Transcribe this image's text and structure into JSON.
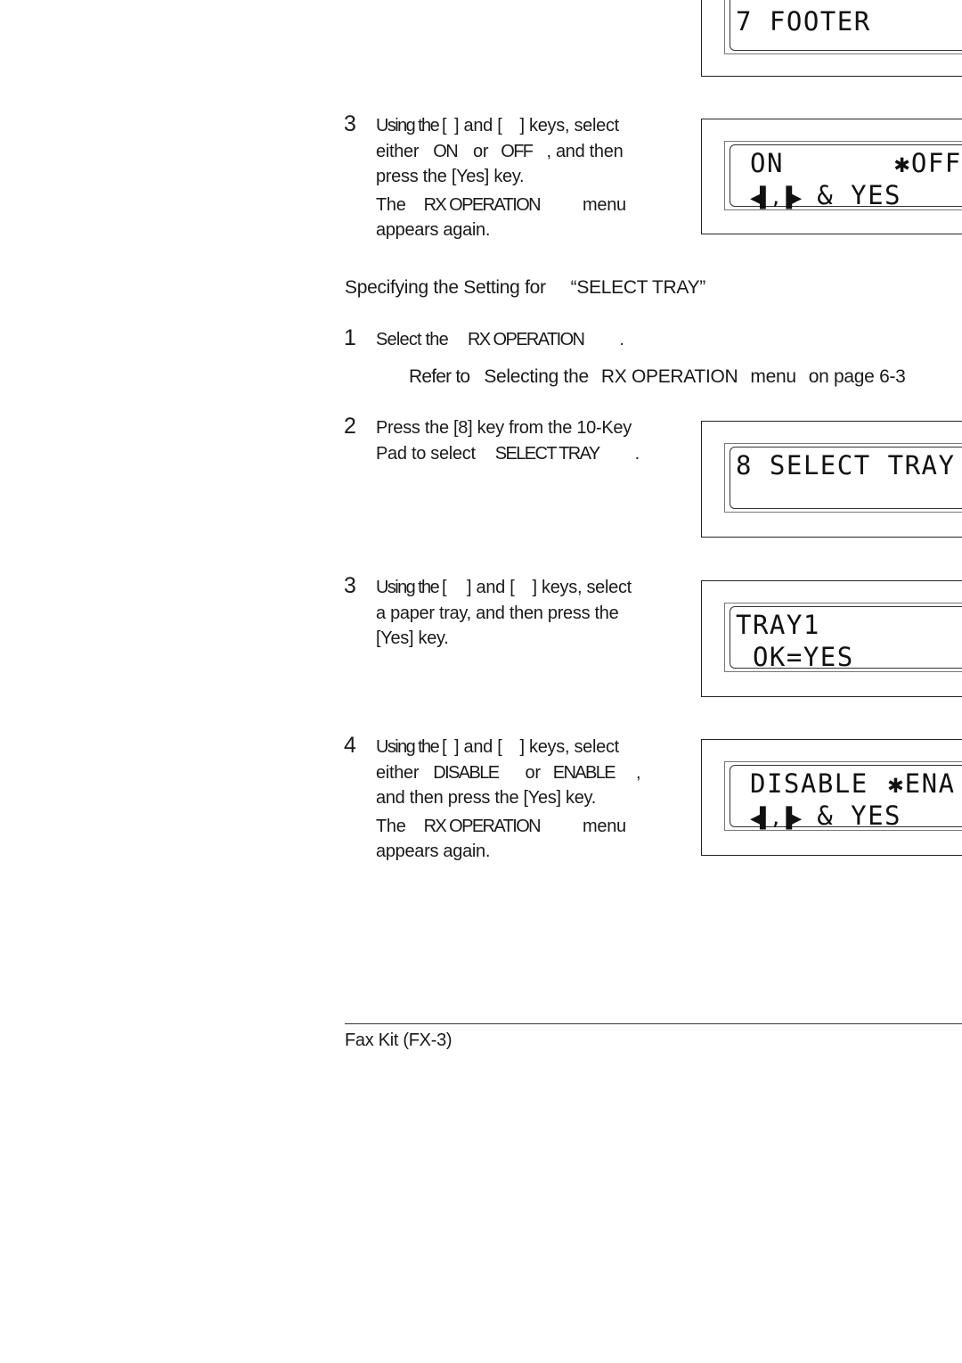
{
  "top_panel": {
    "line1": "7 FOOTER"
  },
  "section_a": {
    "step3": {
      "number": "3",
      "line1_a": "Using the [",
      "line1_b": "] and [",
      "line1_c": "] keys, select",
      "line2_a": "either",
      "line2_on": "ON",
      "line2_or": "or",
      "line2_off": "OFF",
      "line2_end": ", and then",
      "line3": "press the [Yes] key.",
      "note_a": "The",
      "note_menu_name": "RX OPERATION",
      "note_b": "menu",
      "note_line2": "appears again."
    },
    "panel": {
      "line1_left": "ON",
      "line1_right": "✱OFF",
      "arrows": "◀▌,▐▶",
      "line2_rest": "& YES"
    }
  },
  "heading": {
    "prefix": "Specifying the Setting for",
    "quoted": "“SELECT TRAY”"
  },
  "section_b": {
    "step1": {
      "number": "1",
      "text_a": "Select the",
      "menu_name": "RX OPERATION",
      "end": ".",
      "ref_a": "Refer to",
      "ref_b": "Selecting the",
      "ref_menu": "RX OPERATION",
      "ref_c": "menu",
      "ref_d": "on page 6-3"
    },
    "step2": {
      "number": "2",
      "line1": "Press the [8] key from the 10-Key",
      "line2_a": "Pad to select",
      "line2_item": "SELECT TRAY",
      "line2_end": "."
    },
    "panel2": {
      "line1": "8 SELECT TRAY",
      "line2": ""
    },
    "step3": {
      "number": "3",
      "line1_a": "Using the [",
      "line1_b": "] and [",
      "line1_c": "] keys, select",
      "line2": "a paper tray, and then press the",
      "line3": "[Yes] key."
    },
    "panel3": {
      "line1": "TRAY1",
      "line2": " OK=YES"
    },
    "step4": {
      "number": "4",
      "line1_a": "Using the [",
      "line1_b": "] and [",
      "line1_c": "] keys, select",
      "line2_a": "either",
      "line2_disable": "DISABLE",
      "line2_or": "or",
      "line2_enable": "ENABLE",
      "line2_end": ",",
      "line3": "and then press the [Yes] key.",
      "note_a": "The",
      "note_menu_name": "RX OPERATION",
      "note_b": "menu",
      "note_line2": "appears again."
    },
    "panel4": {
      "line1_left": "DISABLE",
      "line1_right": "✱ENA",
      "arrows": "◀▌,▐▶",
      "line2_rest": "& YES"
    }
  },
  "footer": {
    "text": "Fax Kit (FX-3)"
  }
}
